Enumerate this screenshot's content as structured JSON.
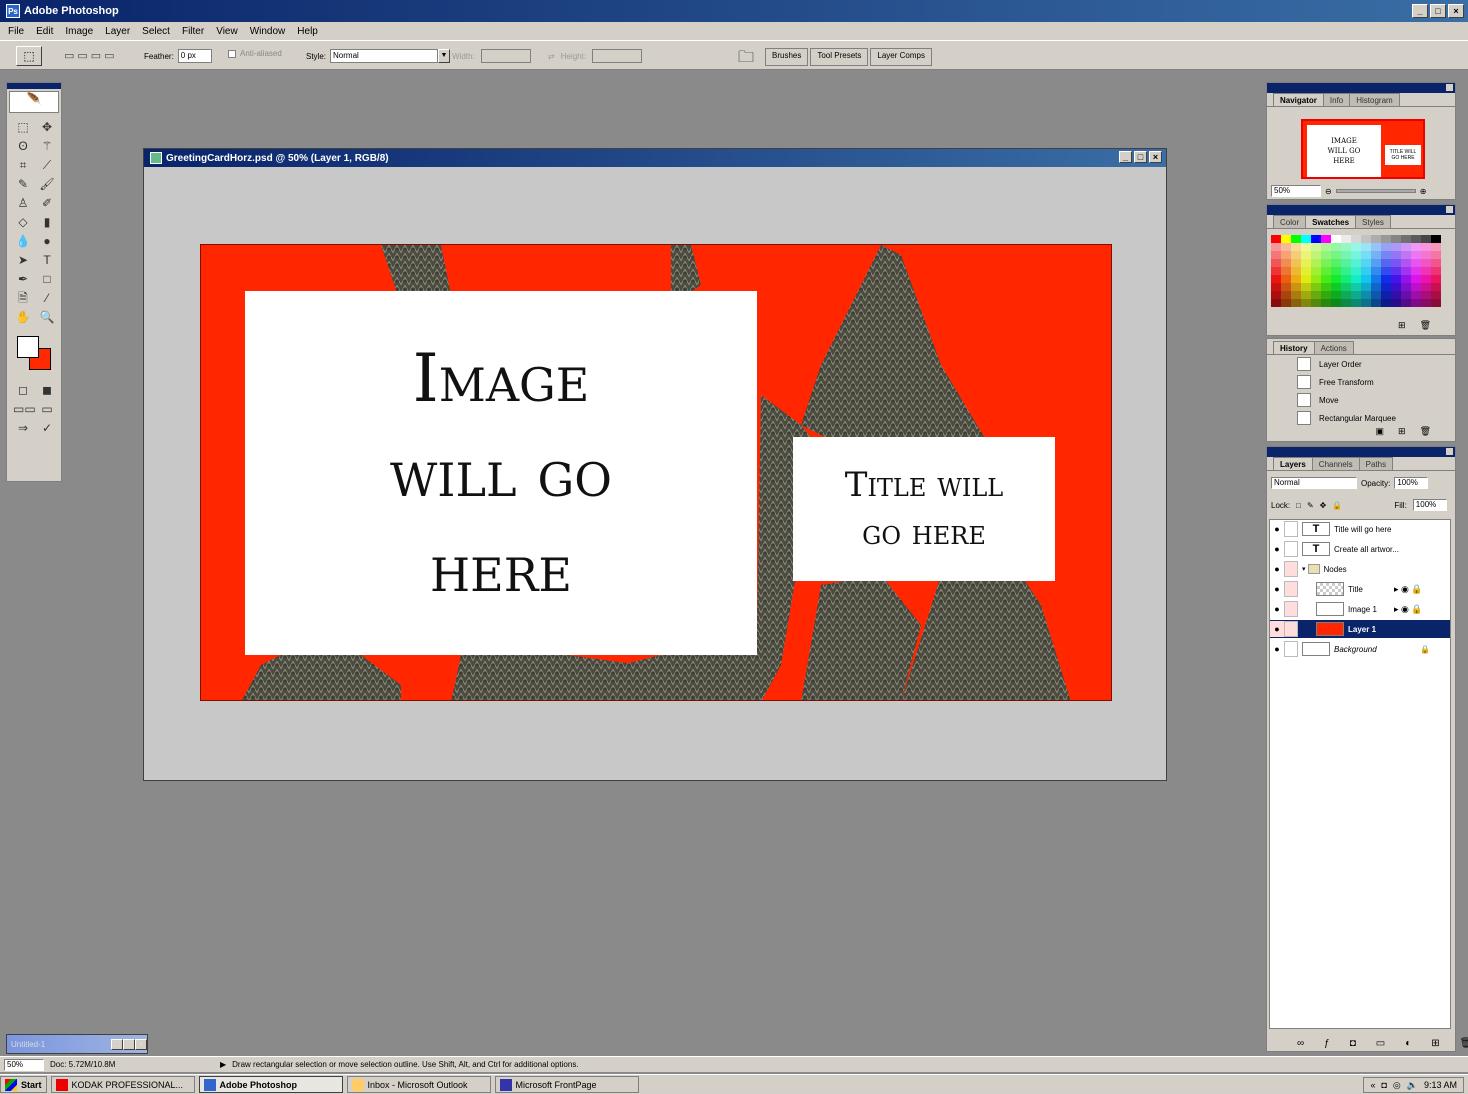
{
  "app": {
    "title": "Adobe Photoshop",
    "controls": [
      "_",
      "□",
      "×"
    ]
  },
  "menu": [
    "File",
    "Edit",
    "Image",
    "Layer",
    "Select",
    "Filter",
    "View",
    "Window",
    "Help"
  ],
  "options": {
    "feather_label": "Feather:",
    "feather_value": "0 px",
    "antialias_label": "Anti-aliased",
    "style_label": "Style:",
    "style_value": "Normal",
    "width_label": "Width:",
    "height_label": "Height:"
  },
  "palette_well": [
    "Brushes",
    "Tool Presets",
    "Layer Comps"
  ],
  "document": {
    "title": "GreetingCardHorz.psd @ 50% (Layer 1, RGB/8)",
    "image_placeholder": [
      "Image",
      "will go",
      "here"
    ],
    "title_placeholder": [
      "Title will",
      "go here"
    ]
  },
  "navigator": {
    "tabs": [
      "Navigator",
      "Info",
      "Histogram"
    ],
    "zoom": "50%",
    "thumb_image": [
      "IMAGE",
      "WILL GO",
      "HERE"
    ],
    "thumb_title": [
      "TITLE WILL",
      "GO HERE"
    ]
  },
  "swatches": {
    "tabs": [
      "Color",
      "Swatches",
      "Styles"
    ],
    "colors": [
      "#ff0000",
      "#ffff00",
      "#00ff00",
      "#00ffff",
      "#0000ff",
      "#ff00ff",
      "#ffffff",
      "#ebebeb",
      "#d6d6d6",
      "#c2c2c2",
      "#adadad",
      "#999999",
      "#858585",
      "#707070",
      "#5c5c5c",
      "#474747",
      "#000000"
    ]
  },
  "history": {
    "tabs": [
      "History",
      "Actions"
    ],
    "items": [
      "Layer Order",
      "Free Transform",
      "Move",
      "Rectangular Marquee"
    ]
  },
  "layers": {
    "tabs": [
      "Layers",
      "Channels",
      "Paths"
    ],
    "blend_mode": "Normal",
    "opacity_label": "Opacity:",
    "opacity": "100%",
    "lock_label": "Lock:",
    "fill_label": "Fill:",
    "fill": "100%",
    "items": [
      {
        "name": "Title will go here",
        "thumb": "T"
      },
      {
        "name": "Create all artwor...",
        "thumb": "T"
      },
      {
        "name": "Nodes",
        "thumb": ""
      },
      {
        "name": "Title",
        "thumb": ""
      },
      {
        "name": "Image 1",
        "thumb": ""
      },
      {
        "name": "Layer 1",
        "thumb": ""
      },
      {
        "name": "Background",
        "thumb": ""
      }
    ]
  },
  "minimized_doc": {
    "title": "Untitled-1"
  },
  "status": {
    "zoom": "50%",
    "doc": "Doc: 5.72M/10.8M",
    "hint": "Draw rectangular selection or move selection outline.  Use Shift, Alt, and Ctrl for additional options."
  },
  "taskbar": {
    "start": "Start",
    "tasks": [
      "KODAK PROFESSIONAL...",
      "Adobe Photoshop",
      "Inbox - Microsoft Outlook",
      "Microsoft FrontPage"
    ],
    "clock": "9:13 AM"
  },
  "colors": {
    "canvas_red": "#ff2600",
    "titlebar": "#0a246a",
    "fg": "#ffffff",
    "bg": "#ff2a00"
  }
}
